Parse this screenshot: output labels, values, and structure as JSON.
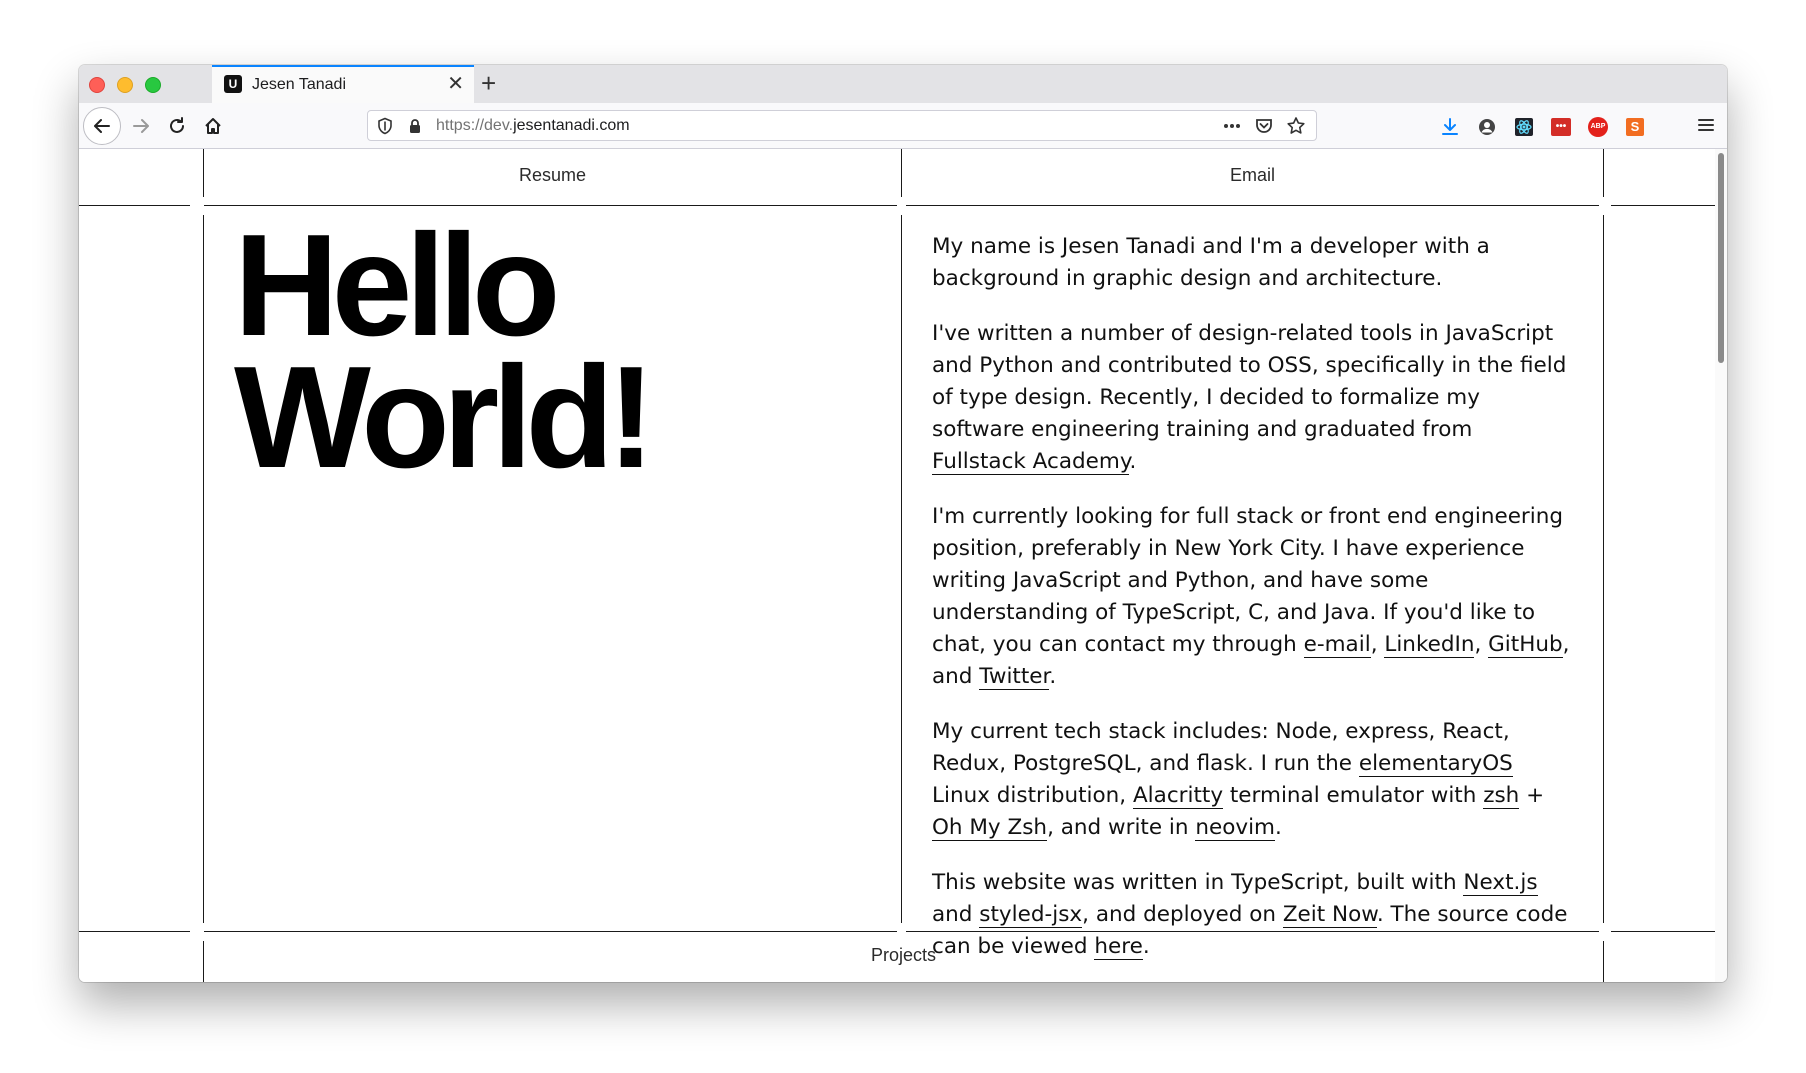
{
  "browser": {
    "tab_title": "Jesen Tanadi",
    "tab_favicon": "U",
    "close_glyph": "✕",
    "newtab_glyph": "+",
    "url_prefix": "https://dev.",
    "url_host": "jesentanadi.com",
    "icons": [
      "back-arrow-icon",
      "forward-arrow-icon",
      "reload-icon",
      "home-icon",
      "shield-icon",
      "lock-icon",
      "more-icon",
      "pocket-icon",
      "bookmark-star-icon",
      "download-icon",
      "account-icon",
      "react-devtools-icon",
      "lastpass-icon",
      "adblock-plus-icon",
      "sumo-icon",
      "hamburger-menu-icon"
    ],
    "ext_labels": {
      "lastpass": "•••",
      "adblock": "ABP",
      "sumo": "S"
    }
  },
  "nav": {
    "resume": "Resume",
    "email": "Email",
    "projects": "Projects"
  },
  "hero": {
    "line1": "Hello",
    "line2": "World!"
  },
  "bio": {
    "p1": "My name is Jesen Tanadi and I'm a developer with a background in graphic design and architecture.",
    "p2_a": "I've written a number of design-related tools in JavaScript and Python and contributed to OSS, specifically in the field of type design. Recently, I decided to formalize my software engineering training and graduated from ",
    "p2_link": "Fullstack Academy",
    "p2_b": ".",
    "p3_a": "I'm currently looking for full stack or front end engineering position, preferably in New York City. I have experience writing JavaScript and Python, and have some understanding of TypeScript, C, and Java. If you'd like to chat, you can contact my through ",
    "p3_email": "e-mail",
    "p3_comma1": ", ",
    "p3_linkedin": "LinkedIn",
    "p3_comma2": ", ",
    "p3_github": "GitHub",
    "p3_and": ", and ",
    "p3_twitter": "Twitter",
    "p3_end": ".",
    "p4_a": "My current tech stack includes: Node, express, React, Redux, PostgreSQL, and flask. I run the ",
    "p4_elementary": "elementaryOS",
    "p4_b": " Linux distribution, ",
    "p4_alacritty": "Alacritty",
    "p4_c": " terminal emulator with ",
    "p4_zsh": "zsh",
    "p4_plus": " + ",
    "p4_ohmyzsh": "Oh My Zsh",
    "p4_d": ", and write in ",
    "p4_neovim": "neovim",
    "p4_end": ".",
    "p5_a": "This website was written in TypeScript, built with ",
    "p5_next": "Next.js",
    "p5_and": " and ",
    "p5_styled": "styled-jsx",
    "p5_b": ", and deployed on ",
    "p5_zeit": "Zeit Now",
    "p5_c": ". The source code can be viewed ",
    "p5_here": "here",
    "p5_end": "."
  }
}
